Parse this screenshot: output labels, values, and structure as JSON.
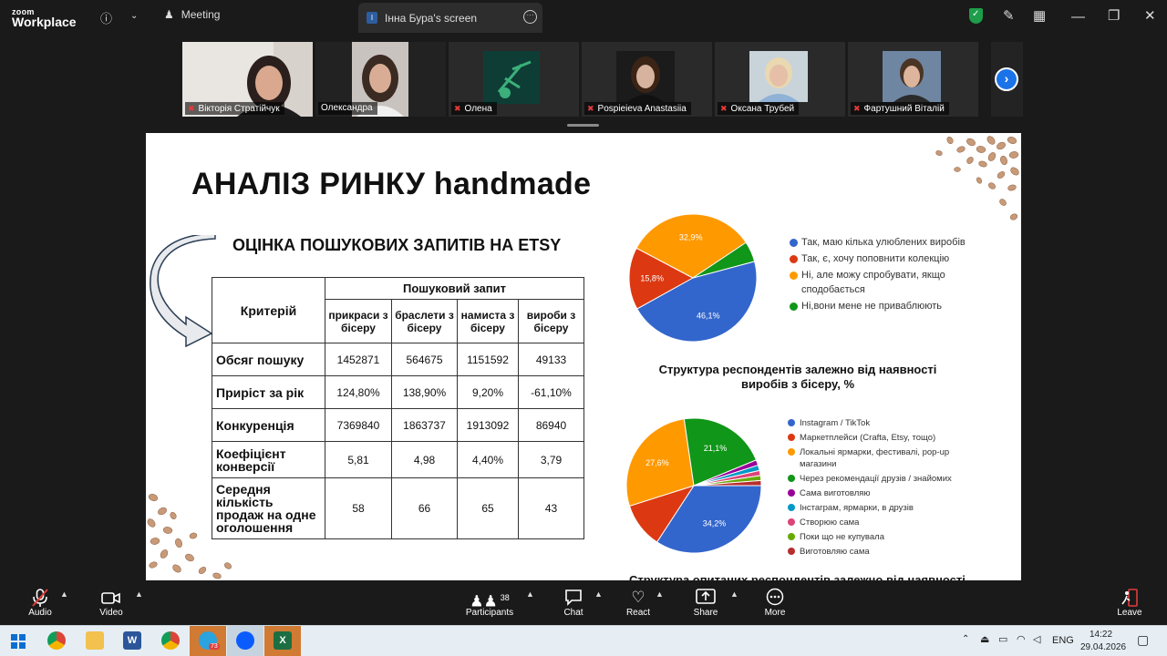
{
  "topbar": {
    "logo_small": "zoom",
    "logo_big": "Workplace",
    "meeting_label": "Meeting",
    "screen_badge": "I",
    "screen_tab_label": "Інна Бура's screen"
  },
  "participants": [
    {
      "name": "Вікторія Стратійчук",
      "muted": true
    },
    {
      "name": "Олександра",
      "muted": false
    },
    {
      "name": "Олена",
      "muted": true
    },
    {
      "name": "Pospieieva Anastasiia",
      "muted": true
    },
    {
      "name": "Оксана Трубей",
      "muted": true
    },
    {
      "name": "Фартушний Віталій",
      "muted": true
    }
  ],
  "slide": {
    "title": "АНАЛІЗ РИНКУ handmade",
    "subtitle": "ОЦІНКА ПОШУКОВИХ ЗАПИТІВ НА ETSY",
    "table": {
      "criteria_header": "Критерій",
      "query_header": "Пошуковий запит",
      "columns": [
        "прикраси з бісеру",
        "браслети з бісеру",
        "намиста з бісеру",
        "вироби з бісеру"
      ],
      "rows": [
        {
          "label": "Обсяг пошуку",
          "values": [
            "1452871",
            "564675",
            "1151592",
            "49133"
          ]
        },
        {
          "label": "Приріст за рік",
          "values": [
            "124,80%",
            "138,90%",
            "9,20%",
            "-61,10%"
          ]
        },
        {
          "label": "Конкуренція",
          "values": [
            "7369840",
            "1863737",
            "1913092",
            "86940"
          ]
        },
        {
          "label": "Коефіцієнт конверсії",
          "values": [
            "5,81",
            "4,98",
            "4,40%",
            "3,79"
          ]
        },
        {
          "label": "Середня кількість продаж на одне оголошення",
          "values": [
            "58",
            "66",
            "65",
            "43"
          ]
        }
      ]
    },
    "chart_caption": "Структура респондентів залежно від наявності виробів з бісеру, %",
    "cut_caption": "Структура опитаних респондентів залежно від наявності"
  },
  "chart_data": [
    {
      "type": "pie",
      "labels": [
        "Так, маю кілька улюблених виробів",
        "Так, є, хочу поповнити колекцію",
        "Ні, але можу спробувати, якщо сподобається",
        "Ні,вони мене не приваблюють"
      ],
      "values": [
        46.1,
        15.8,
        32.9,
        5.2
      ],
      "data_labels": [
        "46,1%",
        "15,8%",
        "32,9%",
        ""
      ],
      "colors": [
        "#3366cc",
        "#dc3912",
        "#ff9900",
        "#109618"
      ],
      "legend_position": "right"
    },
    {
      "type": "pie",
      "labels": [
        "Instagram / TikTok",
        "Маркетплейси (Crafta, Etsy, тощо)",
        "Локальні ярмарки, фестивалі, pop-up магазини",
        "Через рекомендації друзів / знайомих",
        "Сама виготовляю",
        "Інстаграм, ярмарки, в друзів",
        "Створюю сама",
        "Поки що не купувала",
        "Виготовляю сама"
      ],
      "values": [
        34.2,
        10.9,
        27.6,
        21.1,
        1.3,
        1.3,
        1.2,
        1.2,
        1.2
      ],
      "data_labels": [
        "34,2%",
        "",
        "27,6%",
        "21,1%",
        "",
        "",
        "",
        "",
        ""
      ],
      "colors": [
        "#3366cc",
        "#dc3912",
        "#ff9900",
        "#109618",
        "#990099",
        "#0099c6",
        "#dd4477",
        "#66aa00",
        "#b82e2e"
      ],
      "legend_position": "right"
    }
  ],
  "toolbar": {
    "audio": "Audio",
    "video": "Video",
    "participants": "Participants",
    "participants_count": "38",
    "chat": "Chat",
    "react": "React",
    "share": "Share",
    "more": "More",
    "leave": "Leave"
  },
  "taskbar": {
    "telegram_badge": "73",
    "language": "ENG",
    "time": "14:22",
    "date": "29.04.2026"
  }
}
